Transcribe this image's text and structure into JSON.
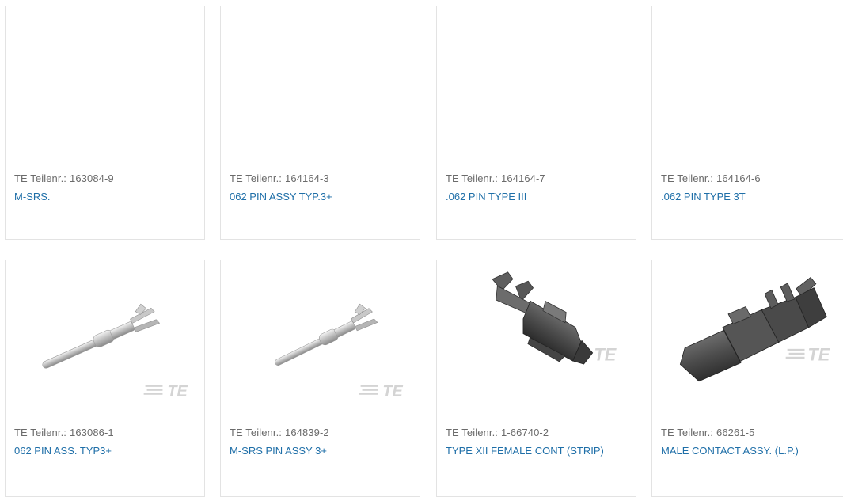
{
  "products": [
    {
      "part_label": "TE Teilenr.:",
      "part_number": "163084-9",
      "name": "M-SRS.",
      "image": "none"
    },
    {
      "part_label": "TE Teilenr.:",
      "part_number": "164164-3",
      "name": "062 PIN ASSY TYP.3+",
      "image": "none"
    },
    {
      "part_label": "TE Teilenr.:",
      "part_number": "164164-7",
      "name": ".062 PIN TYPE III",
      "image": "none"
    },
    {
      "part_label": "TE Teilenr.:",
      "part_number": "164164-6",
      "name": ".062 PIN TYPE 3T",
      "image": "none"
    },
    {
      "part_label": "TE Teilenr.:",
      "part_number": "163086-1",
      "name": "062 PIN ASS. TYP3+",
      "image": "pin-contact-silver"
    },
    {
      "part_label": "TE Teilenr.:",
      "part_number": "164839-2",
      "name": "M-SRS PIN ASSY 3+",
      "image": "pin-contact-silver"
    },
    {
      "part_label": "TE Teilenr.:",
      "part_number": "1-66740-2",
      "name": "TYPE XII FEMALE CONT (STRIP)",
      "image": "female-contact-dark"
    },
    {
      "part_label": "TE Teilenr.:",
      "part_number": "66261-5",
      "name": "MALE CONTACT ASSY. (L.P.)",
      "image": "male-contact-dark"
    }
  ],
  "brand_logo_text": "TE",
  "colors": {
    "link": "#1f6fa8",
    "label": "#6b6b6b",
    "border": "#e3e3e3"
  }
}
